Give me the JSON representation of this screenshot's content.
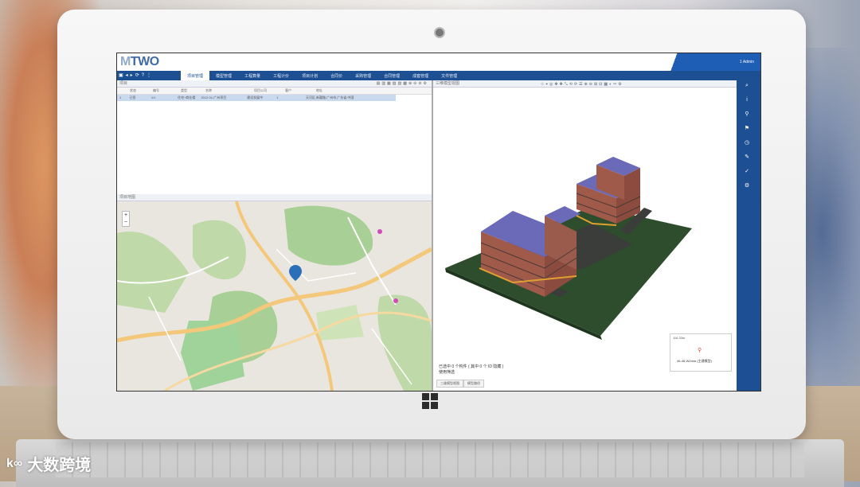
{
  "app": {
    "logo_prefix": "M",
    "logo_suffix": "TWO",
    "search_placeholder": "",
    "user": "1 Admin"
  },
  "nav": {
    "tabs": [
      {
        "label": "项目管理"
      },
      {
        "label": "模型管理"
      },
      {
        "label": "工程算量"
      },
      {
        "label": "工程计价"
      },
      {
        "label": "项目计划"
      },
      {
        "label": "合同价"
      },
      {
        "label": "采购管理"
      },
      {
        "label": "合同管理"
      },
      {
        "label": "成套管理"
      },
      {
        "label": "文件管理"
      }
    ]
  },
  "left_panel": {
    "title": "项目",
    "columns": [
      "",
      "状态",
      "编号",
      "类型",
      "名称",
      "项目公司",
      "客户",
      "地址"
    ],
    "rows": [
      [
        "1",
        "已签",
        "1/1",
        "住宅+商业楼",
        "2012.01-广州项目",
        "建设发展中",
        "1",
        "天河区,新疆路,广州市,广东省,中国"
      ]
    ]
  },
  "map_panel": {
    "title": "项目地图",
    "zoom_in": "+",
    "zoom_out": "−"
  },
  "viewer": {
    "title": "三维模型视图",
    "status_line1": "已选中 0 个构件 ( 其中 0 个 ID 隐藏 )",
    "status_line2": "使用筛选",
    "bottom_tabs": [
      "三维模型视图",
      "模型路径"
    ],
    "inset_top": "116.33m",
    "inset_label": "46-46-W2mm (主建模型)"
  },
  "watermark": {
    "logo": "k∞",
    "text": "大数跨境"
  },
  "colors": {
    "brand_blue": "#1d4f93",
    "accent_blue": "#1e5fb5",
    "selected_row": "#c9d9ee"
  }
}
